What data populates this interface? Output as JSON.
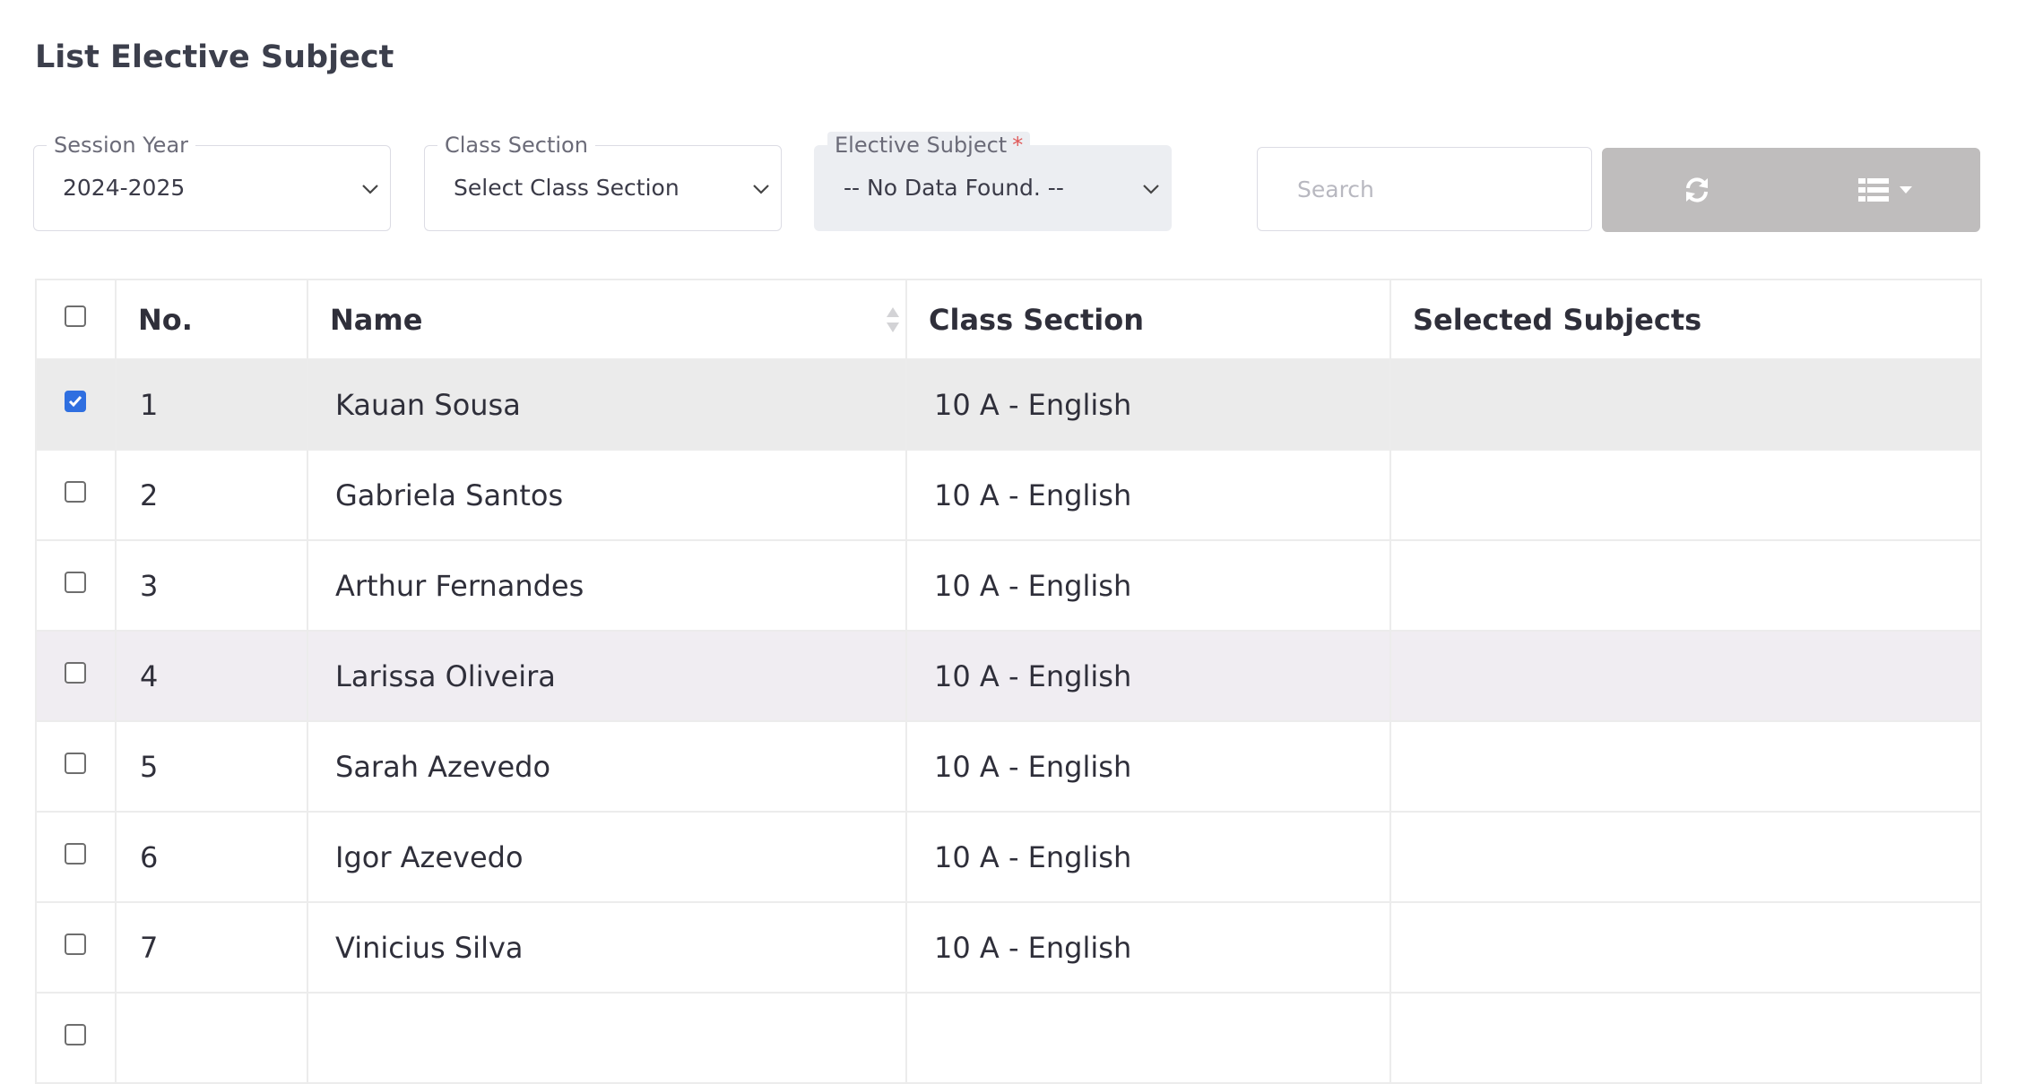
{
  "page": {
    "title": "List Elective Subject"
  },
  "filters": {
    "session_year": {
      "label": "Session Year",
      "value": "2024-2025"
    },
    "class_section": {
      "label": "Class Section",
      "value": "Select Class Section"
    },
    "elective_subject": {
      "label": "Elective Subject",
      "required_mark": "*",
      "value": "-- No Data Found. --"
    }
  },
  "search": {
    "placeholder": "Search",
    "value": ""
  },
  "toolbar": {
    "refresh_icon": "refresh-icon",
    "columns_icon": "list-icon"
  },
  "table": {
    "headers": {
      "no": "No.",
      "name": "Name",
      "class_section": "Class Section",
      "selected_subjects": "Selected Subjects"
    },
    "rows": [
      {
        "no": "1",
        "name": "Kauan Sousa",
        "class_section": "10 A - English",
        "selected_subjects": "",
        "checked": true
      },
      {
        "no": "2",
        "name": "Gabriela Santos",
        "class_section": "10 A - English",
        "selected_subjects": "",
        "checked": false
      },
      {
        "no": "3",
        "name": "Arthur Fernandes",
        "class_section": "10 A - English",
        "selected_subjects": "",
        "checked": false
      },
      {
        "no": "4",
        "name": "Larissa Oliveira",
        "class_section": "10 A - English",
        "selected_subjects": "",
        "checked": false
      },
      {
        "no": "5",
        "name": "Sarah Azevedo",
        "class_section": "10 A - English",
        "selected_subjects": "",
        "checked": false
      },
      {
        "no": "6",
        "name": "Igor Azevedo",
        "class_section": "10 A - English",
        "selected_subjects": "",
        "checked": false
      },
      {
        "no": "7",
        "name": "Vinicius Silva",
        "class_section": "10 A - English",
        "selected_subjects": "",
        "checked": false
      },
      {
        "no": "",
        "name": "",
        "class_section": "",
        "selected_subjects": "",
        "checked": false
      }
    ]
  },
  "colors": {
    "checkbox_checked": "#2f6fe0",
    "button_group": "#bfbdbd",
    "selected_row": "#ebebeb",
    "hover_row": "#f0edf2",
    "required": "#e05858"
  }
}
